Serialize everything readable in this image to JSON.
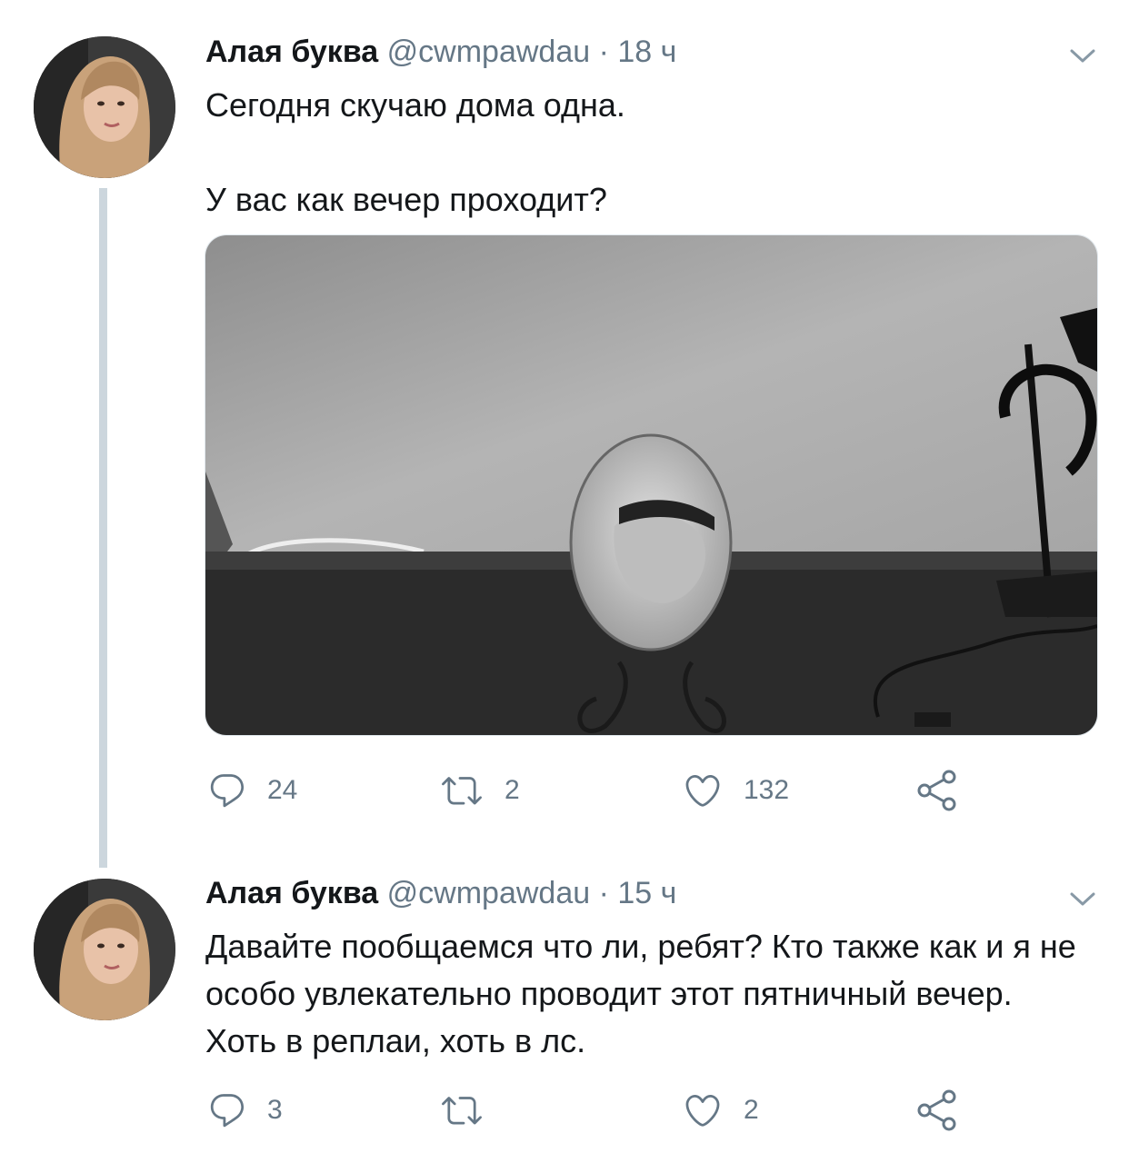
{
  "tweets": [
    {
      "author_name": "Алая буква",
      "handle": "@cwmpawdau",
      "separator": "·",
      "time": "18 ч",
      "paragraphs": [
        "Сегодня скучаю дома одна.",
        "У вас как вечер проходит?"
      ],
      "replies": "24",
      "retweets": "2",
      "likes": "132"
    },
    {
      "author_name": "Алая буква",
      "handle": "@cwmpawdau",
      "separator": "·",
      "time": "15 ч",
      "paragraphs": [
        "Давайте пообщаемся что ли, ребят? Кто также как и я не особо увлекательно проводит этот пятничный вечер. Хоть в реплаи, хоть в лс."
      ],
      "replies": "3",
      "retweets": "",
      "likes": "2"
    }
  ],
  "icons": {
    "reply": "reply-icon",
    "retweet": "retweet-icon",
    "like": "heart-icon",
    "share": "share-icon",
    "caret": "chevron-down-icon"
  },
  "colors": {
    "text": "#14171a",
    "secondary": "#657786",
    "thread_line": "#ccd6dd"
  }
}
